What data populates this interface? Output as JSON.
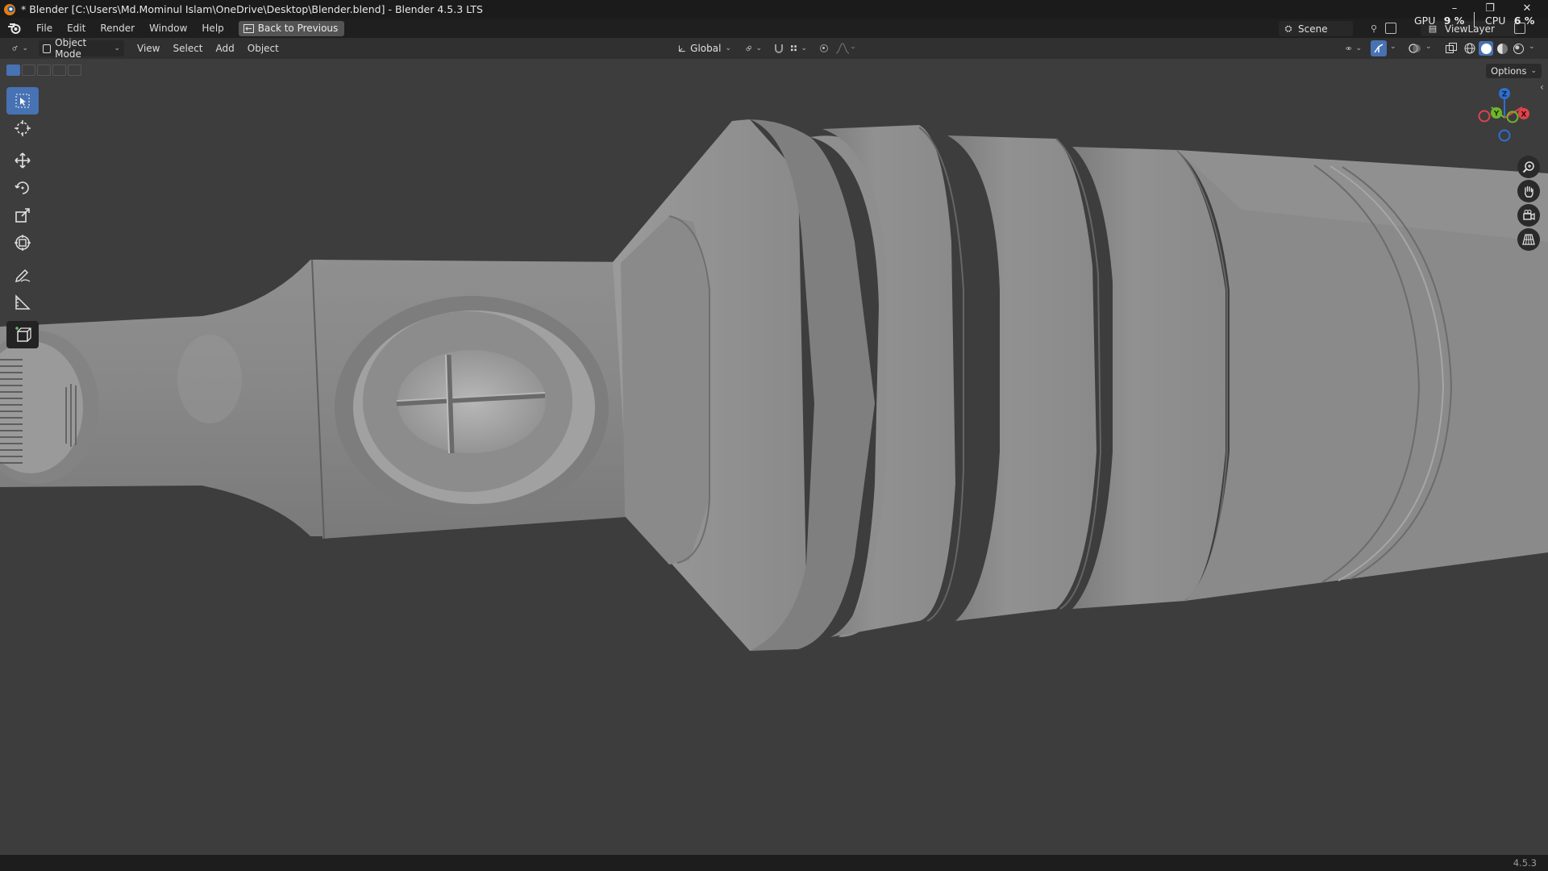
{
  "window": {
    "title": "* Blender [C:\\Users\\Md.Mominul Islam\\OneDrive\\Desktop\\Blender.blend] - Blender 4.5.3 LTS",
    "minimize": "–",
    "restore": "❐",
    "close": "✕"
  },
  "menubar": {
    "items": [
      "File",
      "Edit",
      "Render",
      "Window",
      "Help"
    ],
    "back_button": "Back to Previous",
    "scene": "Scene",
    "view_layer": "ViewLayer",
    "gpu_label": "GPU",
    "gpu_value": "9 %",
    "cpu_label": "CPU",
    "cpu_value": "6 %"
  },
  "header": {
    "mode": "Object Mode",
    "menus": [
      "View",
      "Select",
      "Add",
      "Object"
    ],
    "transform_orientation": "Global"
  },
  "viewport": {
    "options_label": "Options",
    "background_color": "#3d3d3d",
    "active_color": "#4772b3",
    "gizmo": {
      "x": "X",
      "y": "Y",
      "z": "Z"
    },
    "tools": [
      "select-box",
      "cursor",
      "move",
      "rotate",
      "scale",
      "transform",
      "annotate",
      "measure",
      "add-cube"
    ]
  },
  "statusbar": {
    "version": "4.5.3"
  }
}
